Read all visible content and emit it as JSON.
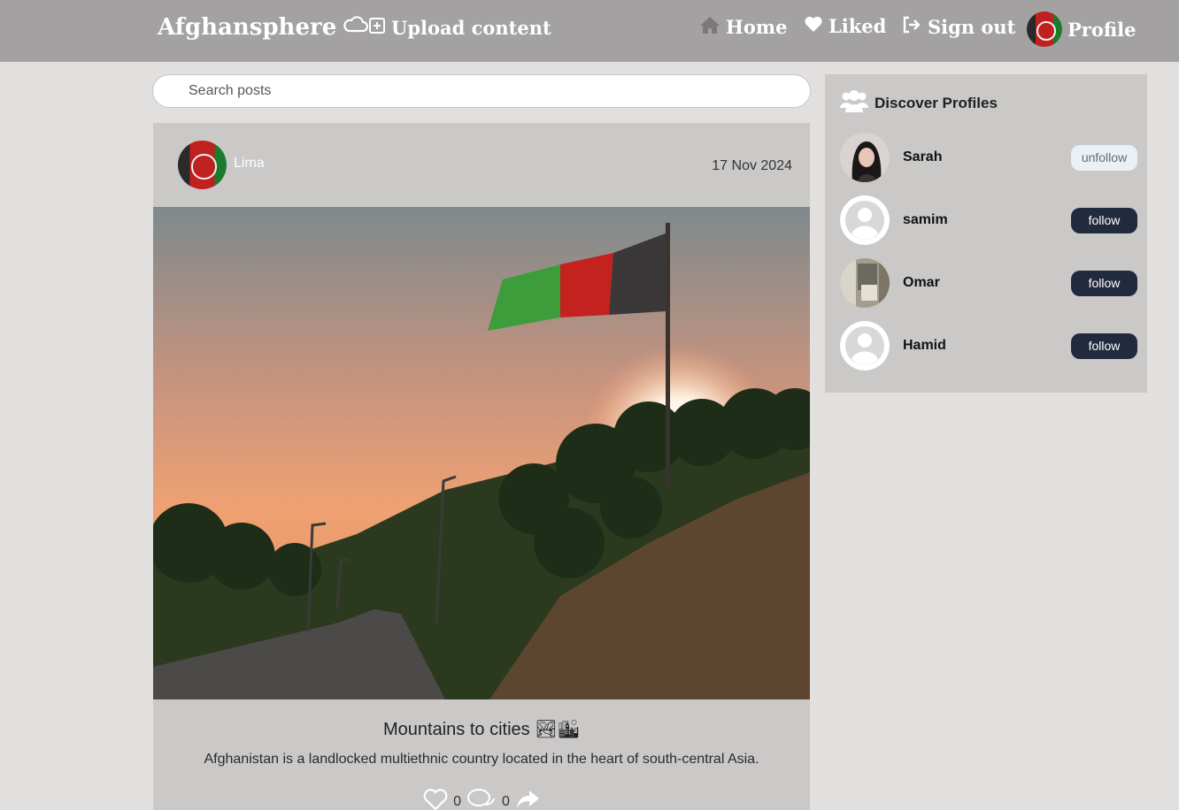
{
  "header": {
    "brand": "Afghansphere",
    "nav": {
      "upload": "Upload content",
      "home": "Home",
      "liked": "Liked",
      "signout": "Sign out",
      "profile": "Profile"
    }
  },
  "search": {
    "placeholder": "Search posts"
  },
  "post": {
    "author": "Lima",
    "date": "17 Nov 2024",
    "title": "Mountains to cities 🏞🏙",
    "description": "Afghanistan is a landlocked multiethnic country located in the heart of south-central Asia.",
    "likes": "0",
    "comments": "0"
  },
  "discover": {
    "title": "Discover Profiles",
    "profiles": [
      {
        "name": "Sarah",
        "action": "unfollow"
      },
      {
        "name": "samim",
        "action": "follow"
      },
      {
        "name": "Omar",
        "action": "follow"
      },
      {
        "name": "Hamid",
        "action": "follow"
      }
    ]
  },
  "colors": {
    "header_bg": "#a3a1a1",
    "page_bg": "#e2e0df",
    "card_bg": "#cbc9c8",
    "follow_btn": "#222a3d",
    "unfollow_btn": "#e9f1f6"
  },
  "icons": {
    "brand": "cloud-icon",
    "upload": "plus-square-icon",
    "home": "home-icon",
    "liked": "heart-icon",
    "signout": "sign-out-icon",
    "discover": "users-icon",
    "like_action": "heart-outline-icon",
    "comment_action": "comments-icon",
    "share_action": "share-icon"
  }
}
